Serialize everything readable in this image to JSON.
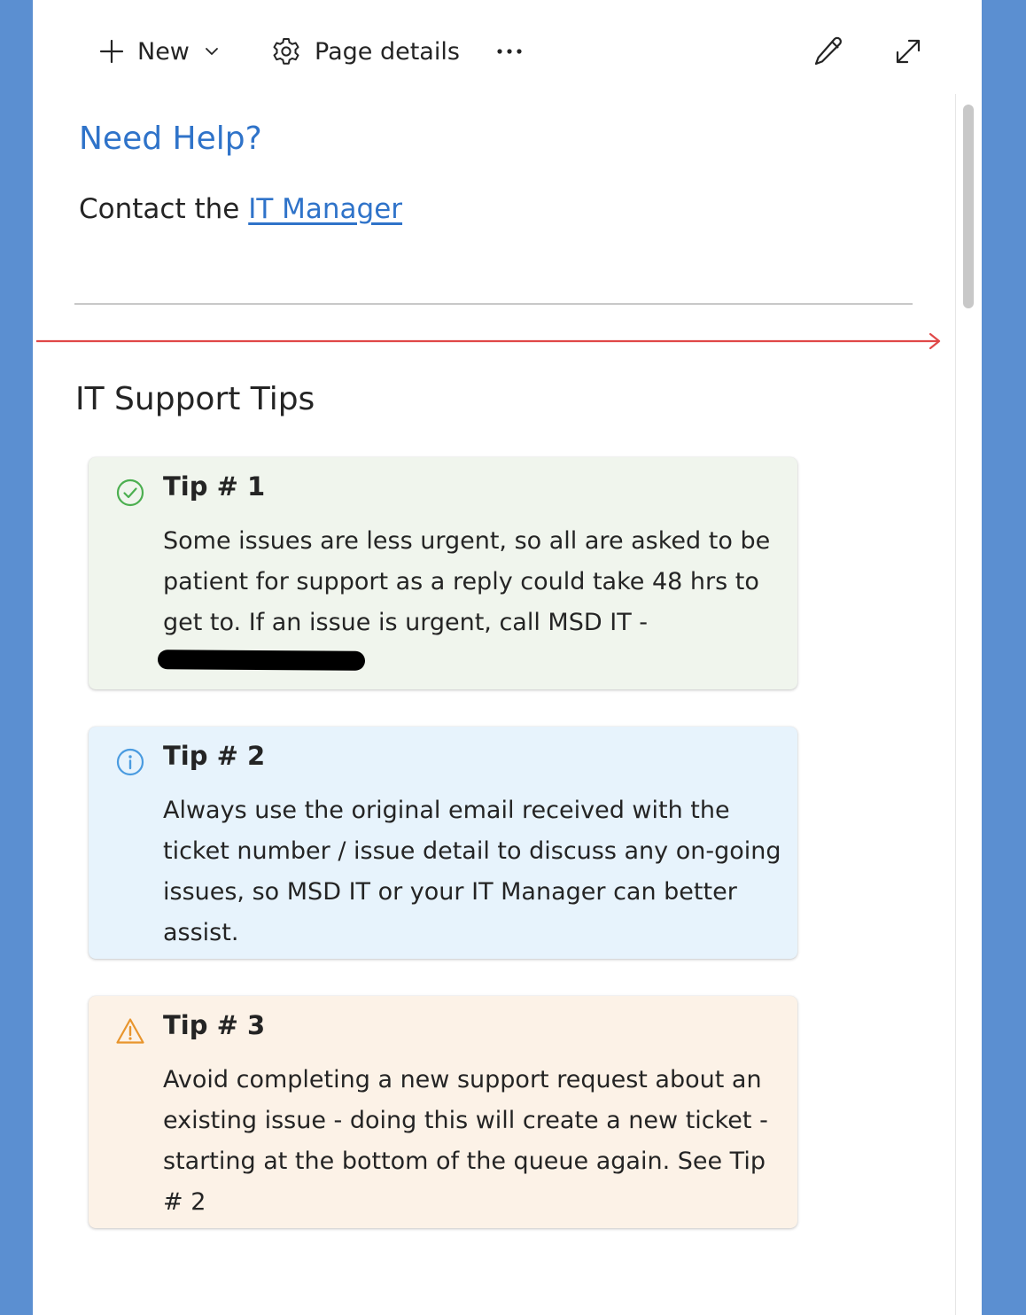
{
  "toolbar": {
    "new_label": "New",
    "page_details_label": "Page details"
  },
  "help": {
    "title": "Need Help?",
    "contact_prefix": "Contact the ",
    "contact_link": "IT Manager"
  },
  "tips_section": {
    "title": "IT Support Tips",
    "tips": [
      {
        "title": "Tip # 1",
        "text": "Some issues are less urgent, so all are asked to be patient for support as a reply could take 48 hrs to get to. If an issue is urgent, call MSD IT -",
        "icon": "check-circle-icon",
        "color": "#f0f5ed",
        "icon_color": "#4caf50"
      },
      {
        "title": "Tip # 2",
        "text": "Always use the original email received with the ticket number / issue detail to discuss any on-going issues, so MSD IT or your IT Manager can better assist.",
        "icon": "info-icon",
        "color": "#e7f3fc",
        "icon_color": "#4a9be0"
      },
      {
        "title": "Tip # 3",
        "text": "Avoid completing a new support request about an existing issue - doing this will create a new ticket - starting at the bottom of the queue again. See Tip # 2",
        "icon": "warning-icon",
        "color": "#fcf2e7",
        "icon_color": "#e8952d"
      }
    ]
  },
  "colors": {
    "accent": "#2f73c9",
    "background": "#5b8fd1",
    "annotation": "#e04848"
  }
}
